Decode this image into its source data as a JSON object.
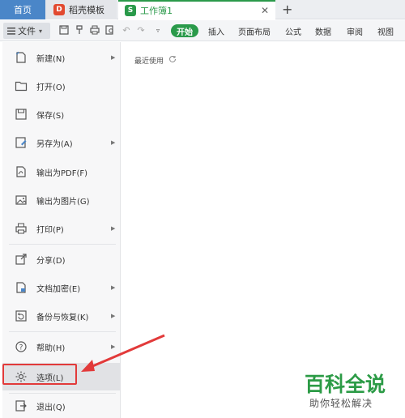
{
  "tabs": {
    "home": "首页",
    "template": "稻壳模板",
    "workbook": "工作簿1",
    "workbook_icon_letter": "S",
    "template_icon_letter": "D"
  },
  "toolbar": {
    "file_label": "文件",
    "start_label": "开始",
    "ribbon_tabs": [
      "插入",
      "页面布局",
      "公式",
      "数据",
      "审阅",
      "视图"
    ]
  },
  "file_menu": {
    "items": [
      {
        "label": "新建(N)",
        "icon": "new-doc-icon",
        "submenu": true
      },
      {
        "label": "打开(O)",
        "icon": "folder-icon",
        "submenu": false
      },
      {
        "label": "保存(S)",
        "icon": "save-icon",
        "submenu": false
      },
      {
        "label": "另存为(A)",
        "icon": "save-as-icon",
        "submenu": true
      },
      {
        "label": "输出为PDF(F)",
        "icon": "pdf-icon",
        "submenu": false
      },
      {
        "label": "输出为图片(G)",
        "icon": "image-icon",
        "submenu": false
      },
      {
        "label": "打印(P)",
        "icon": "print-icon",
        "submenu": true
      },
      {
        "label": "分享(D)",
        "icon": "share-icon",
        "submenu": false
      },
      {
        "label": "文档加密(E)",
        "icon": "lock-doc-icon",
        "submenu": true
      },
      {
        "label": "备份与恢复(K)",
        "icon": "backup-icon",
        "submenu": true
      },
      {
        "label": "帮助(H)",
        "icon": "help-icon",
        "submenu": true
      },
      {
        "label": "选项(L)",
        "icon": "gear-icon",
        "submenu": false,
        "selected": true
      },
      {
        "label": "退出(Q)",
        "icon": "exit-icon",
        "submenu": false
      }
    ]
  },
  "recent": {
    "label": "最近使用"
  },
  "watermark": {
    "main": "百科全说",
    "sub": "助你轻松解决"
  },
  "colors": {
    "accent_green": "#2a9a4a",
    "home_tab_blue": "#4a86c8",
    "highlight_red": "#e23a3a"
  }
}
